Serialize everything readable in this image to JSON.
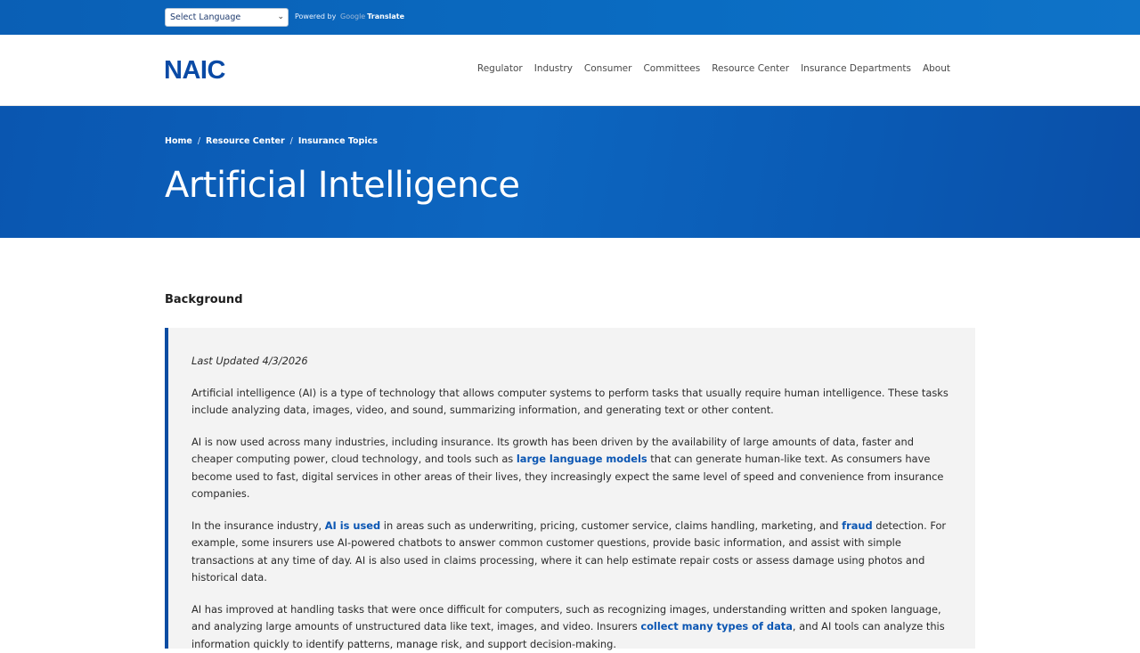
{
  "translate_bar": {
    "select_label": "Select Language",
    "powered_by": "Powered by",
    "google": "Google",
    "translate": "Translate"
  },
  "header": {
    "logo_text": "NAIC",
    "nav": [
      "Regulator",
      "Industry",
      "Consumer",
      "Committees",
      "Resource Center",
      "Insurance Departments",
      "About"
    ]
  },
  "hero": {
    "breadcrumb": [
      "Home",
      "Resource Center",
      "Insurance Topics"
    ],
    "title": "Artificial Intelligence"
  },
  "content": {
    "section_title": "Background",
    "last_updated": "Last Updated 4/3/2026",
    "p1": "Artificial intelligence (AI) is a type of technology that allows computer systems to perform tasks that usually require human intelligence. These tasks include analyzing data, images, video, and sound, summarizing information, and generating text or other content.",
    "p2_a": "AI is now used across many industries, including insurance. Its growth has been driven by the availability of large amounts of data, faster and cheaper computing power, cloud technology, and tools such as ",
    "p2_link": "large language models",
    "p2_b": " that can generate human-like text. As consumers have become used to fast, digital services in other areas of their lives, they increasingly expect the same level of speed and convenience from insurance companies.",
    "p3_a": "In the insurance industry, ",
    "p3_link1": "AI is used",
    "p3_b": " in areas such as underwriting, pricing, customer service, claims handling, marketing, and ",
    "p3_link2": "fraud",
    "p3_c": " detection. For example, some insurers use AI-powered chatbots to answer common customer questions, provide basic information, and assist with simple transactions at any time of day. AI is also used in claims processing, where it can help estimate repair costs or assess damage using photos and historical data.",
    "p4_a": "AI has improved at handling tasks that were once difficult for computers, such as recognizing images, understanding written and spoken language, and analyzing large amounts of unstructured data like text, images, and video. Insurers ",
    "p4_link": "collect many types of data",
    "p4_b": ", and AI tools can analyze this information quickly to identify patterns, manage risk, and support decision-making."
  },
  "colors": {
    "brand_blue": "#0a4aa5",
    "link_blue": "#0b56b3",
    "panel_bg": "#f3f3f3"
  }
}
